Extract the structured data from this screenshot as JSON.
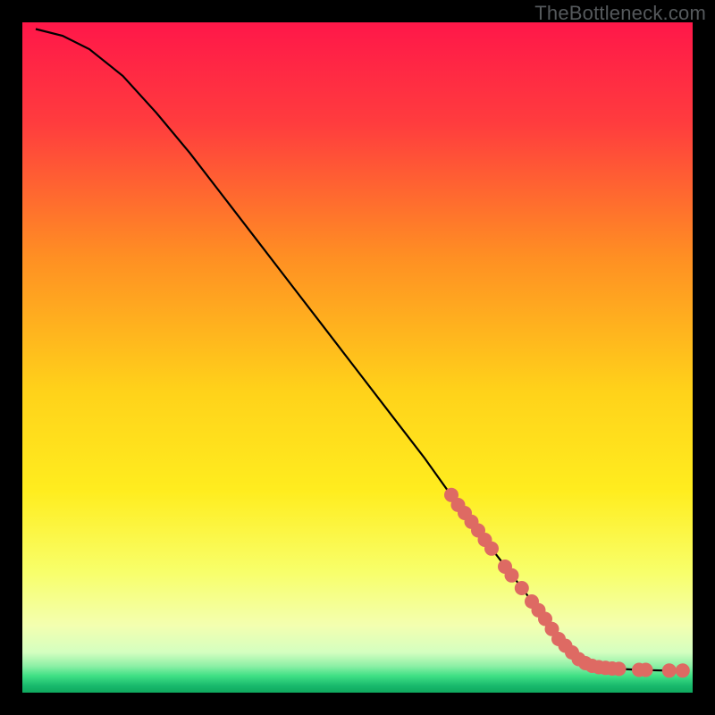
{
  "watermark": "TheBottleneck.com",
  "chart_data": {
    "type": "line",
    "title": "",
    "xlabel": "",
    "ylabel": "",
    "xlim": [
      0,
      100
    ],
    "ylim": [
      0,
      100
    ],
    "gradient_colors": {
      "top": "#ff1749",
      "upper_mid": "#ff8f23",
      "mid": "#ffe81a",
      "lower": "#f7ff70",
      "bottom_band": "#38e082",
      "bottom_edge": "#0fa85e"
    },
    "curve": {
      "name": "black-curve",
      "color": "#000000",
      "points": [
        {
          "x": 2,
          "y": 99
        },
        {
          "x": 6,
          "y": 98
        },
        {
          "x": 10,
          "y": 96
        },
        {
          "x": 15,
          "y": 92
        },
        {
          "x": 20,
          "y": 86.5
        },
        {
          "x": 25,
          "y": 80.5
        },
        {
          "x": 30,
          "y": 74
        },
        {
          "x": 35,
          "y": 67.5
        },
        {
          "x": 40,
          "y": 61
        },
        {
          "x": 45,
          "y": 54.5
        },
        {
          "x": 50,
          "y": 48
        },
        {
          "x": 55,
          "y": 41.5
        },
        {
          "x": 60,
          "y": 35
        },
        {
          "x": 65,
          "y": 28
        },
        {
          "x": 70,
          "y": 21.5
        },
        {
          "x": 75,
          "y": 15
        },
        {
          "x": 80,
          "y": 8
        },
        {
          "x": 83,
          "y": 5
        },
        {
          "x": 85,
          "y": 4
        },
        {
          "x": 88,
          "y": 3.6
        },
        {
          "x": 92,
          "y": 3.4
        },
        {
          "x": 96,
          "y": 3.3
        },
        {
          "x": 99,
          "y": 3.3
        }
      ]
    },
    "markers": {
      "name": "highlighted-dots",
      "color": "#de6a63",
      "radius_px": 8,
      "points": [
        {
          "x": 64,
          "y": 29.5
        },
        {
          "x": 65,
          "y": 28
        },
        {
          "x": 66,
          "y": 26.8
        },
        {
          "x": 67,
          "y": 25.5
        },
        {
          "x": 68,
          "y": 24.2
        },
        {
          "x": 69,
          "y": 22.8
        },
        {
          "x": 70,
          "y": 21.5
        },
        {
          "x": 72,
          "y": 18.8
        },
        {
          "x": 73,
          "y": 17.5
        },
        {
          "x": 74.5,
          "y": 15.6
        },
        {
          "x": 76,
          "y": 13.6
        },
        {
          "x": 77,
          "y": 12.3
        },
        {
          "x": 78,
          "y": 11
        },
        {
          "x": 79,
          "y": 9.5
        },
        {
          "x": 80,
          "y": 8
        },
        {
          "x": 81,
          "y": 7
        },
        {
          "x": 82,
          "y": 6
        },
        {
          "x": 83,
          "y": 5
        },
        {
          "x": 84,
          "y": 4.4
        },
        {
          "x": 85,
          "y": 4
        },
        {
          "x": 86,
          "y": 3.8
        },
        {
          "x": 87,
          "y": 3.7
        },
        {
          "x": 88,
          "y": 3.6
        },
        {
          "x": 89,
          "y": 3.55
        },
        {
          "x": 92,
          "y": 3.4
        },
        {
          "x": 93,
          "y": 3.4
        },
        {
          "x": 96.5,
          "y": 3.3
        },
        {
          "x": 98.5,
          "y": 3.3
        }
      ]
    }
  }
}
